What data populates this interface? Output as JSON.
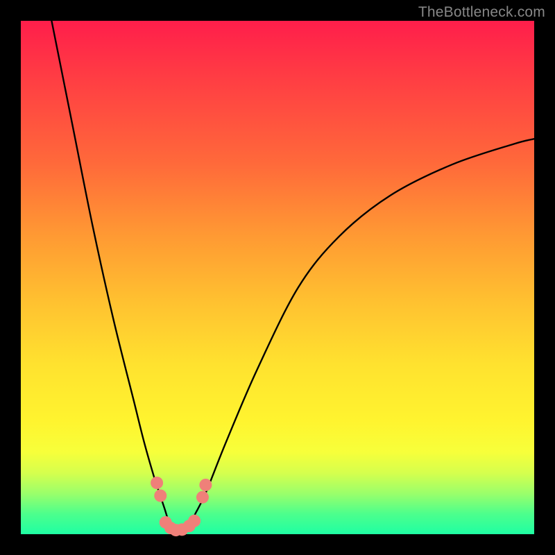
{
  "watermark": "TheBottleneck.com",
  "chart_data": {
    "type": "line",
    "title": "",
    "xlabel": "",
    "ylabel": "",
    "xlim": [
      0,
      100
    ],
    "ylim": [
      0,
      100
    ],
    "series": [
      {
        "name": "bottleneck-curve",
        "x": [
          6,
          10,
          14,
          18,
          22,
          24,
          26,
          27,
          28,
          29,
          30,
          31,
          32,
          33,
          34,
          36,
          40,
          46,
          54,
          62,
          72,
          84,
          96,
          100
        ],
        "y": [
          100,
          80,
          60,
          42,
          26,
          18,
          11,
          8,
          5,
          2,
          1,
          0.5,
          1,
          2,
          4,
          8,
          18,
          32,
          48,
          58,
          66,
          72,
          76,
          77
        ]
      }
    ],
    "markers": {
      "name": "highlight-dots",
      "color": "#ef8079",
      "points": [
        {
          "x": 26.5,
          "y": 10
        },
        {
          "x": 27.2,
          "y": 7.5
        },
        {
          "x": 28.2,
          "y": 2.3
        },
        {
          "x": 29.2,
          "y": 1.2
        },
        {
          "x": 30.2,
          "y": 0.8
        },
        {
          "x": 31.4,
          "y": 0.9
        },
        {
          "x": 32.8,
          "y": 1.6
        },
        {
          "x": 33.8,
          "y": 2.6
        },
        {
          "x": 35.4,
          "y": 7.2
        },
        {
          "x": 36.0,
          "y": 9.6
        }
      ]
    }
  }
}
